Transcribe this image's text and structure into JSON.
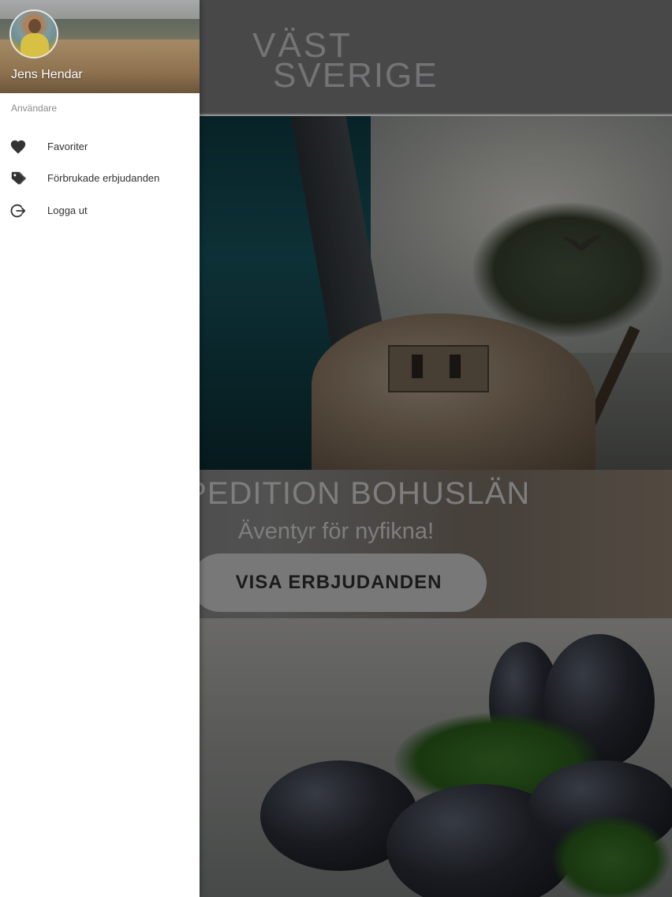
{
  "header": {
    "logo_line1": "VÄST",
    "logo_line2": "SVERIGE"
  },
  "promo": {
    "title": "EXPEDITION BOHUSLÄN",
    "subtitle": "Äventyr för nyfikna!",
    "cta_label": "VISA ERBJUDANDEN"
  },
  "drawer": {
    "user_name": "Jens Hendar",
    "section_label": "Användare",
    "items": [
      {
        "label": "Favoriter",
        "icon": "heart-icon"
      },
      {
        "label": "Förbrukade erbjudanden",
        "icon": "tags-icon"
      },
      {
        "label": "Logga ut",
        "icon": "logout-icon"
      }
    ]
  },
  "colors": {
    "drawer_bg": "#ffffff",
    "icon_color": "#333333",
    "header_bg": "#7d7d7f",
    "cta_bg": "#cfcfcf"
  }
}
